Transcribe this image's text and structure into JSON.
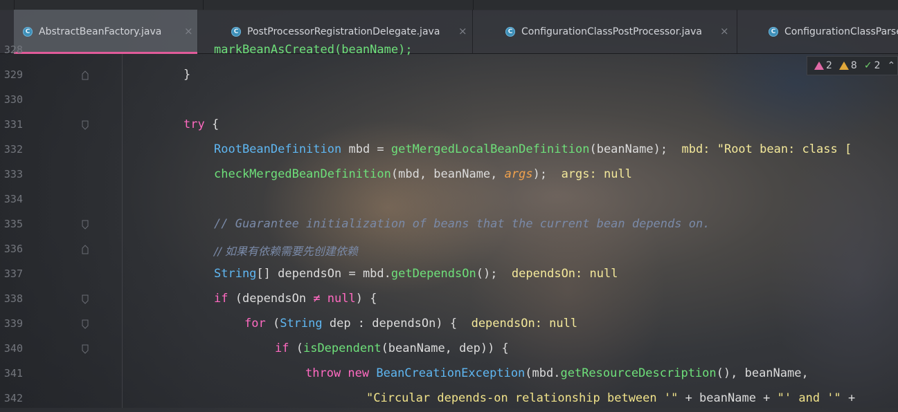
{
  "tabs": [
    {
      "label": "AbstractBeanFactory.java",
      "icon": "C",
      "active": true
    },
    {
      "label": "PostProcessorRegistrationDelegate.java",
      "icon": "C",
      "active": false
    },
    {
      "label": "ConfigurationClassPostProcessor.java",
      "icon": "C",
      "active": false
    },
    {
      "label": "ConfigurationClassParser",
      "icon": "C",
      "active": false
    }
  ],
  "close_glyph": "×",
  "inspections": {
    "errors": "2",
    "warnings": "8",
    "typos": "2"
  },
  "lines": {
    "l328": "328",
    "l329": "329",
    "l330": "330",
    "l331": "331",
    "l332": "332",
    "l333": "333",
    "l334": "334",
    "l335": "335",
    "l336": "336",
    "l337": "337",
    "l338": "338",
    "l339": "339",
    "l340": "340",
    "l341": "341",
    "l342": "342"
  },
  "code": {
    "c328": "markBeanAsCreated(beanName);",
    "c329": "}",
    "c331_kw": "try",
    "c331_rest": " {",
    "c332_type": "RootBeanDefinition",
    "c332_a": " mbd = ",
    "c332_fn": "getMergedLocalBeanDefinition",
    "c332_b": "(beanName);",
    "c332_hint": "mbd: \"Root bean: class [",
    "c333_fn": "checkMergedBeanDefinition",
    "c333_a": "(mbd, beanName, ",
    "c333_param": "args",
    "c333_b": ");",
    "c333_hint": "args: null",
    "c335_comment": "// Guarantee initialization of beans that the current bean depends on.",
    "c336_comment": "// 如果有依赖需要先创建依赖",
    "c337_type": "String",
    "c337_a": "[] dependsOn = mbd.",
    "c337_fn": "getDependsOn",
    "c337_b": "();",
    "c337_hint": "dependsOn: null",
    "c338_kw": "if",
    "c338_a": " (dependsOn ",
    "c338_op": "≠",
    "c338_kw2": " null",
    "c338_b": ") {",
    "c339_kw": "for",
    "c339_a": " (",
    "c339_type": "String",
    "c339_b": " dep : dependsOn) {",
    "c339_hint": "dependsOn: null",
    "c340_kw": "if",
    "c340_a": " (",
    "c340_fn": "isDependent",
    "c340_b": "(beanName, dep)) {",
    "c341_kw": "throw new",
    "c341_type": " BeanCreationException",
    "c341_a": "(mbd.",
    "c341_fn": "getResourceDescription",
    "c341_b": "(), beanName,",
    "c342_str": "\"Circular depends-on relationship between '\"",
    "c342_a": " + beanName + ",
    "c342_str2": "\"' and '\"",
    "c342_b": " +"
  }
}
